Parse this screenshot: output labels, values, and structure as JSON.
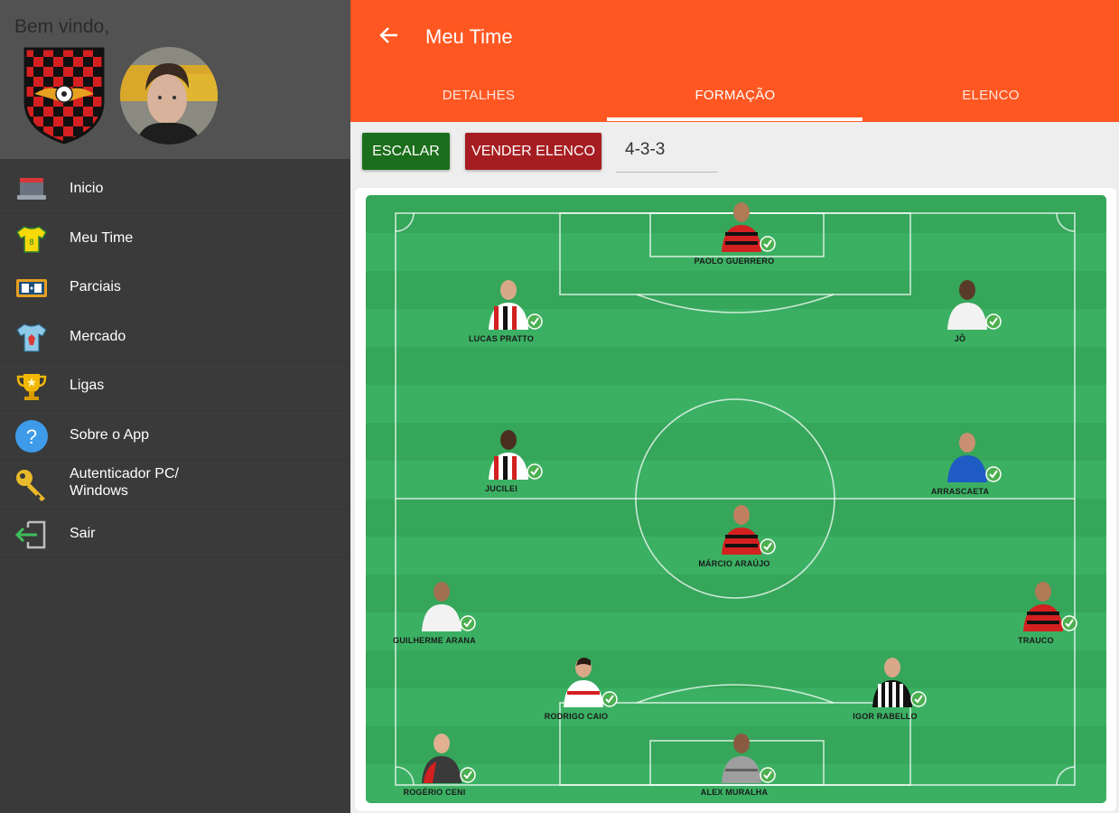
{
  "drawer": {
    "welcome": "Bem vindo,",
    "items": [
      {
        "label": "Inicio",
        "icon": "computer-monitor-icon"
      },
      {
        "label": "Meu Time",
        "icon": "shirt-icon"
      },
      {
        "label": "Parciais",
        "icon": "scoreboard-icon"
      },
      {
        "label": "Mercado",
        "icon": "shop-shirt-icon"
      },
      {
        "label": "Ligas",
        "icon": "trophy-icon"
      },
      {
        "label": "Sobre o App",
        "icon": "question-icon"
      },
      {
        "label": "Autenticador PC/ Windows",
        "icon": "key-icon"
      },
      {
        "label": "Sair",
        "icon": "exit-icon"
      }
    ]
  },
  "appbar": {
    "title": "Meu Time",
    "tabs": [
      {
        "label": "DETALHES",
        "active": false
      },
      {
        "label": "FORMAÇÃO",
        "active": true
      },
      {
        "label": "ELENCO",
        "active": false
      }
    ]
  },
  "toolbar": {
    "escalar_label": "ESCALAR",
    "vender_label": "VENDER ELENCO",
    "formation": "4-3-3"
  },
  "colors": {
    "accent": "#ff5722",
    "drawer": "#3a3a3a",
    "escalar": "#1b6e1b",
    "vender": "#a61d21",
    "field": "#35a65a"
  },
  "players": [
    {
      "name": "PAOLO GUERRERO",
      "kit": "flamengo"
    },
    {
      "name": "LUCAS PRATTO",
      "kit": "saopaulo"
    },
    {
      "name": "JÔ",
      "kit": "corinthians"
    },
    {
      "name": "JUCILEI",
      "kit": "saopaulo"
    },
    {
      "name": "ARRASCAETA",
      "kit": "cruzeiro"
    },
    {
      "name": "MÁRCIO ARAÚJO",
      "kit": "flamengo"
    },
    {
      "name": "GUILHERME ARANA",
      "kit": "corinthians"
    },
    {
      "name": "TRAUCO",
      "kit": "flamengo"
    },
    {
      "name": "RODRIGO CAIO",
      "kit": "saopaulo-white"
    },
    {
      "name": "IGOR RABELLO",
      "kit": "botafogo"
    },
    {
      "name": "ROGÉRIO CENI",
      "kit": "coach"
    },
    {
      "name": "ALEX MURALHA",
      "kit": "goalkeeper"
    }
  ]
}
